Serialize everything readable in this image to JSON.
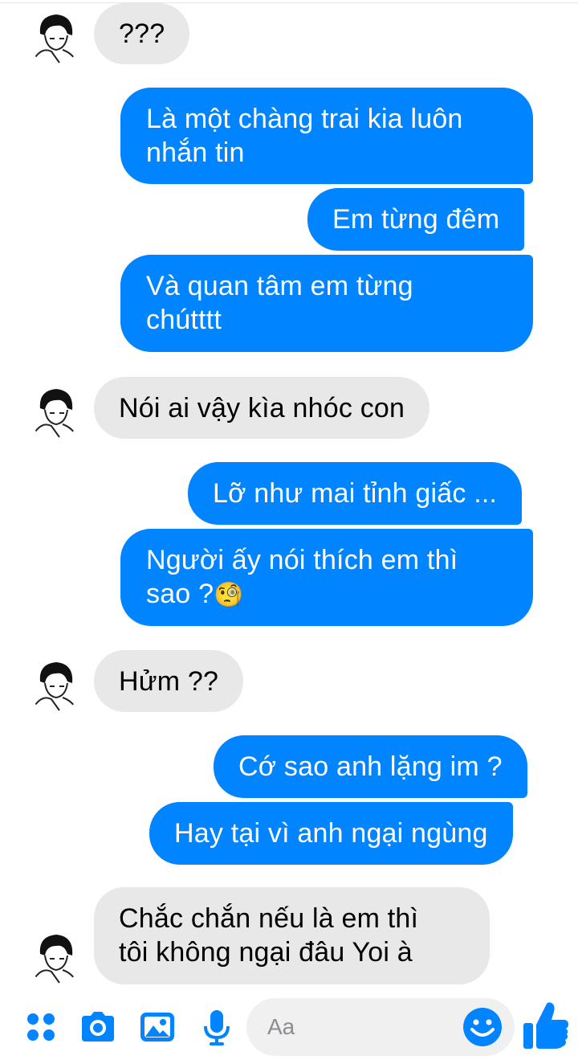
{
  "messages": [
    {
      "side": "in",
      "text": "???"
    },
    {
      "side": "out",
      "text": "Là một chàng trai kia luôn\nnhắn tin"
    },
    {
      "side": "out",
      "text": "Em từng đêm"
    },
    {
      "side": "out",
      "text": "Và quan tâm em từng\nchútttt"
    },
    {
      "side": "in",
      "text": "Nói ai vậy kìa nhóc con"
    },
    {
      "side": "out",
      "text": "Lỡ như mai tỉnh giấc ..."
    },
    {
      "side": "out",
      "text": "Người ấy nói thích em thì\nsao ?",
      "emoji": "🧐"
    },
    {
      "side": "in",
      "text": "Hửm ??"
    },
    {
      "side": "out",
      "text": "Cớ sao anh lặng im ?"
    },
    {
      "side": "out",
      "text": "Hay tại vì anh ngại ngùng"
    },
    {
      "side": "in",
      "text": "Chắc chắn nếu là em thì\ntôi không ngại đâu Yoi à"
    }
  ],
  "composer": {
    "placeholder": "Aa",
    "icons": [
      "apps-icon",
      "camera-icon",
      "image-icon",
      "microphone-icon",
      "emoji-icon",
      "thumbs-up-icon"
    ]
  },
  "colors": {
    "accent": "#0084ff",
    "incoming_bubble": "#e8e8e8",
    "input_bg": "#f0f0f0"
  }
}
